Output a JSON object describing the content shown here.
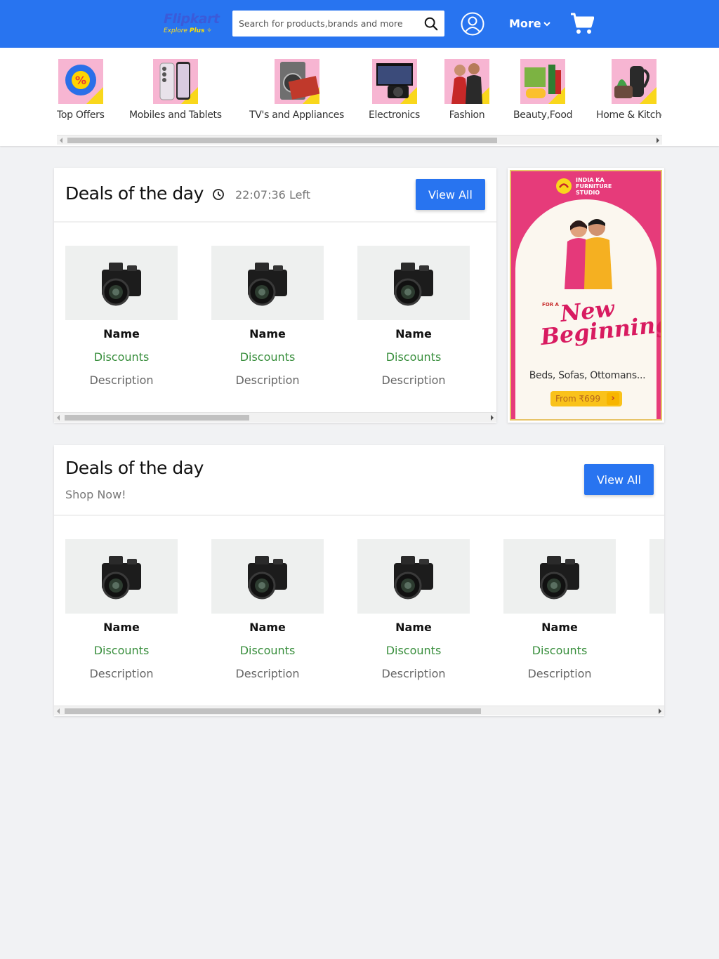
{
  "header": {
    "logo_text": "Flipkart",
    "logo_sub": "Explore",
    "logo_plus": "Plus",
    "search_placeholder": "Search for products,brands and more",
    "more_label": "More",
    "brand_color": "#2874f0"
  },
  "categories": [
    {
      "label": "Top Offers",
      "icon": "offer-badge-icon"
    },
    {
      "label": "Mobiles and Tablets",
      "icon": "phone-icon"
    },
    {
      "label": "TV's and Appliances",
      "icon": "washing-machine-icon"
    },
    {
      "label": "Electronics",
      "icon": "monitor-camera-icon"
    },
    {
      "label": "Fashion",
      "icon": "fashion-models-icon"
    },
    {
      "label": "Beauty,Food",
      "icon": "beauty-products-icon"
    },
    {
      "label": "Home & Kitchen",
      "icon": "kettle-icon"
    }
  ],
  "deals_section_1": {
    "title": "Deals of the day",
    "timer": "22:07:36 Left",
    "view_all": "View All",
    "products": [
      {
        "name": "Name",
        "discount": "Discounts",
        "description": "Description"
      },
      {
        "name": "Name",
        "discount": "Discounts",
        "description": "Description"
      },
      {
        "name": "Name",
        "discount": "Discounts",
        "description": "Description"
      }
    ]
  },
  "ad_banner": {
    "studio_line1": "INDIA KA",
    "studio_line2": "FURNITURE",
    "studio_line3": "STUDIO",
    "for_a": "FOR A",
    "headline": "New Beginning",
    "subtitle": "Beds, Sofas, Ottomans...",
    "cta": "From ₹699"
  },
  "deals_section_2": {
    "title": "Deals of the day",
    "subtitle": "Shop Now!",
    "view_all": "View All",
    "products": [
      {
        "name": "Name",
        "discount": "Discounts",
        "description": "Description"
      },
      {
        "name": "Name",
        "discount": "Discounts",
        "description": "Description"
      },
      {
        "name": "Name",
        "discount": "Discounts",
        "description": "Description"
      },
      {
        "name": "Name",
        "discount": "Discounts",
        "description": "Description"
      }
    ]
  }
}
